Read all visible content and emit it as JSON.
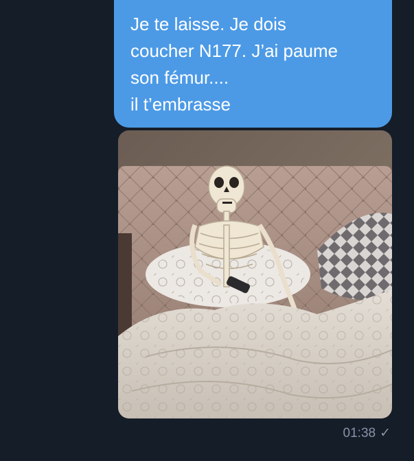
{
  "message": {
    "text": "Je te laisse. Je dois\ncoucher N177. J’ai paume\nson fémur....\nil t’embrasse",
    "time": "01:38",
    "status_icon": "check-icon",
    "bubble_color": "#4c9ae6"
  },
  "photo": {
    "subject": "skeleton-in-bed-photo"
  }
}
